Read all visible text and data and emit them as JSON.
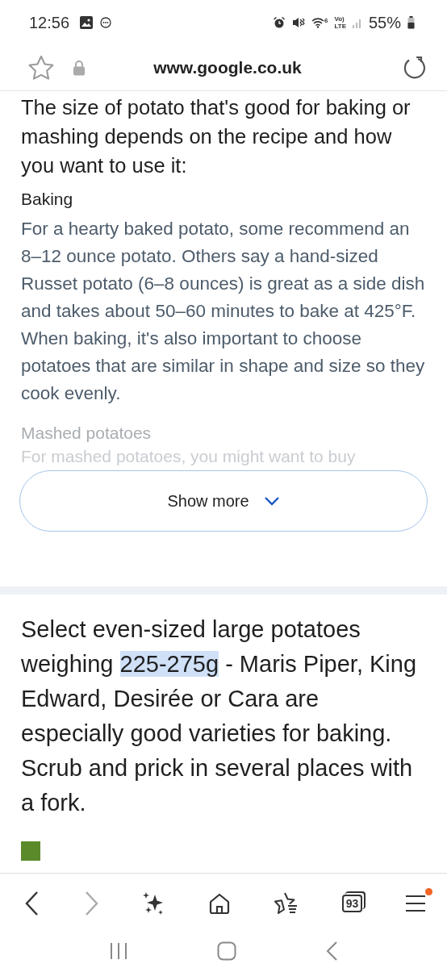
{
  "status_bar": {
    "time": "12:56",
    "battery": "55%",
    "lte_top": "Vo)",
    "lte_bottom": "LTE",
    "wifi_sub": "6"
  },
  "address_bar": {
    "url": "www.google.co.uk",
    "bookmarked": false
  },
  "answer": {
    "intro": "The size of potato that's good for baking or mashing depends on the recipe and how you want to use it:",
    "sections": [
      {
        "heading": "Baking",
        "text": "For a hearty baked potato, some recommend an 8–12 ounce potato. Others say a hand-sized Russet potato (6–8 ounces) is great as a side dish and takes about 50–60 minutes to bake at 425°F. When baking, it's also important to choose potatoes that are similar in shape and size so they cook evenly.",
        "faded": false
      },
      {
        "heading": "Mashed potatoes",
        "text": "For mashed potatoes, you might want to buy",
        "faded": true
      }
    ],
    "show_more": "Show more"
  },
  "snippet": {
    "before": "Select even-sized large potatoes weighing ",
    "highlight": "225-275g",
    "after": " - Maris Piper, King Edward, Desirée or Cara are especially good varieties for baking. Scrub and prick in several places with a fork."
  },
  "toolbar": {
    "back_disabled": false,
    "forward_disabled": true,
    "tab_count": "93",
    "menu_badge": true
  }
}
